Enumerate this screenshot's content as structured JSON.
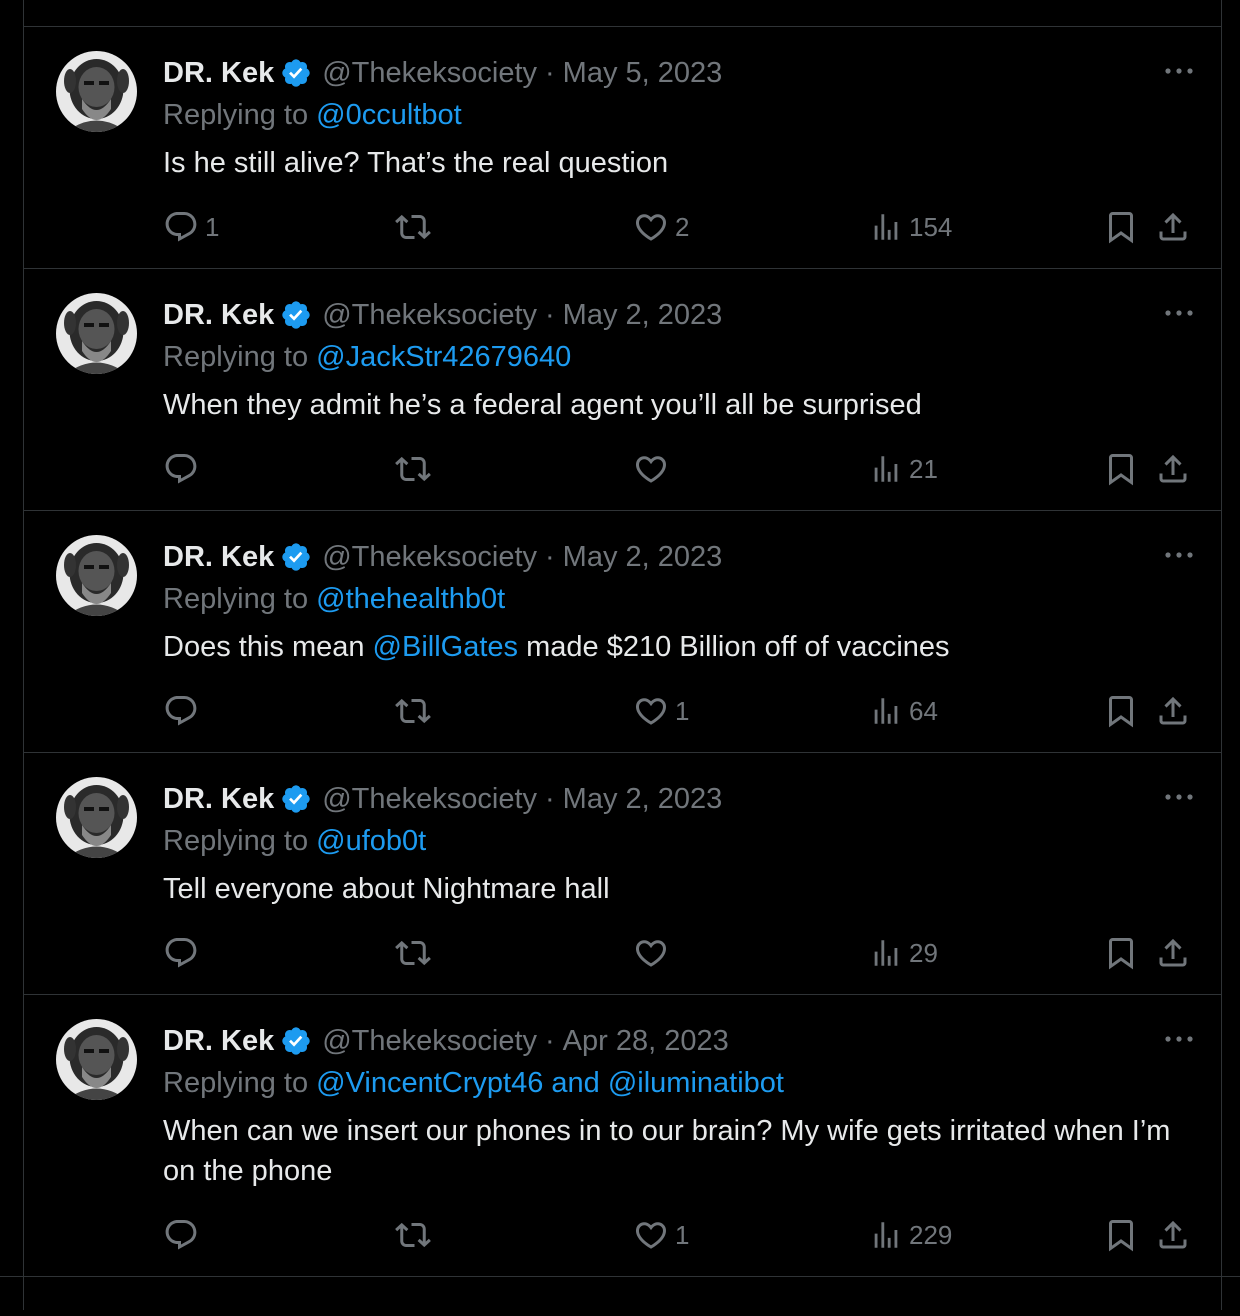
{
  "tweets": [
    {
      "name": "DR. Kek",
      "handle": "@Thekeksociety",
      "sep": "·",
      "date": "May 5, 2023",
      "replying_prefix": "Replying to ",
      "replying_to": "@0ccultbot",
      "replying_and": "",
      "replying_to2": "",
      "text_a": "Is he still alive? That’s the real question",
      "text_mention": "",
      "text_b": "",
      "replies": "1",
      "retweets": "",
      "likes": "2",
      "views": "154"
    },
    {
      "name": "DR. Kek",
      "handle": "@Thekeksociety",
      "sep": "·",
      "date": "May 2, 2023",
      "replying_prefix": "Replying to ",
      "replying_to": "@JackStr42679640",
      "replying_and": "",
      "replying_to2": "",
      "text_a": "When they admit he’s a federal agent you’ll all be surprised",
      "text_mention": "",
      "text_b": "",
      "replies": "",
      "retweets": "",
      "likes": "",
      "views": "21"
    },
    {
      "name": "DR. Kek",
      "handle": "@Thekeksociety",
      "sep": "·",
      "date": "May 2, 2023",
      "replying_prefix": "Replying to ",
      "replying_to": "@thehealthb0t",
      "replying_and": "",
      "replying_to2": "",
      "text_a": "Does this mean ",
      "text_mention": "@BillGates",
      "text_b": " made $210 Billion off of vaccines",
      "replies": "",
      "retweets": "",
      "likes": "1",
      "views": "64"
    },
    {
      "name": "DR. Kek",
      "handle": "@Thekeksociety",
      "sep": "·",
      "date": "May 2, 2023",
      "replying_prefix": "Replying to ",
      "replying_to": "@ufob0t",
      "replying_and": "",
      "replying_to2": "",
      "text_a": "Tell everyone about Nightmare hall",
      "text_mention": "",
      "text_b": "",
      "replies": "",
      "retweets": "",
      "likes": "",
      "views": "29"
    },
    {
      "name": "DR. Kek",
      "handle": "@Thekeksociety",
      "sep": "·",
      "date": "Apr 28, 2023",
      "replying_prefix": "Replying to ",
      "replying_to": "@VincentCrypt46",
      "replying_and": " and ",
      "replying_to2": "@iluminatibot",
      "text_a": "When can we insert our phones in to our brain? My wife gets irritated when I’m on the phone",
      "text_mention": "",
      "text_b": "",
      "replies": "",
      "retweets": "",
      "likes": "1",
      "views": "229"
    }
  ],
  "colors": {
    "background": "#000000",
    "text": "#e7e9ea",
    "secondary": "#71767b",
    "accent": "#1d9bf0",
    "border": "#2f3336"
  },
  "icons": [
    "verified-badge-icon",
    "more-icon",
    "reply-icon",
    "retweet-icon",
    "like-icon",
    "views-icon",
    "bookmark-icon",
    "share-icon"
  ]
}
